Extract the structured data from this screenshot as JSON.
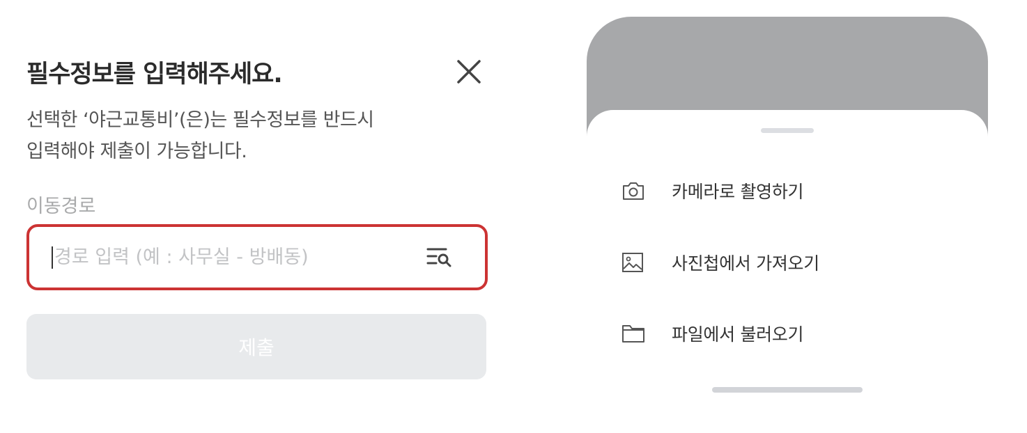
{
  "modal": {
    "title": "필수정보를 입력해주세요.",
    "description_line1": "선택한 ‘야근교통비’(은)는 필수정보를 반드시",
    "description_line2": "입력해야 제출이 가능합니다.",
    "field_label": "이동경로",
    "route_input": {
      "value": "",
      "placeholder": "경로 입력 (예 : 사무실 - 방배동)"
    },
    "submit_label": "제출",
    "icons": {
      "close": "close-icon",
      "search": "list-search-icon"
    },
    "colors": {
      "input_border_highlight": "#cc3333",
      "submit_disabled_bg": "#e8eaec"
    }
  },
  "sheet": {
    "items": [
      {
        "label": "카메라로 촬영하기",
        "icon": "camera-icon"
      },
      {
        "label": "사진첩에서 가져오기",
        "icon": "image-icon"
      },
      {
        "label": "파일에서 불러오기",
        "icon": "folder-icon"
      }
    ]
  }
}
